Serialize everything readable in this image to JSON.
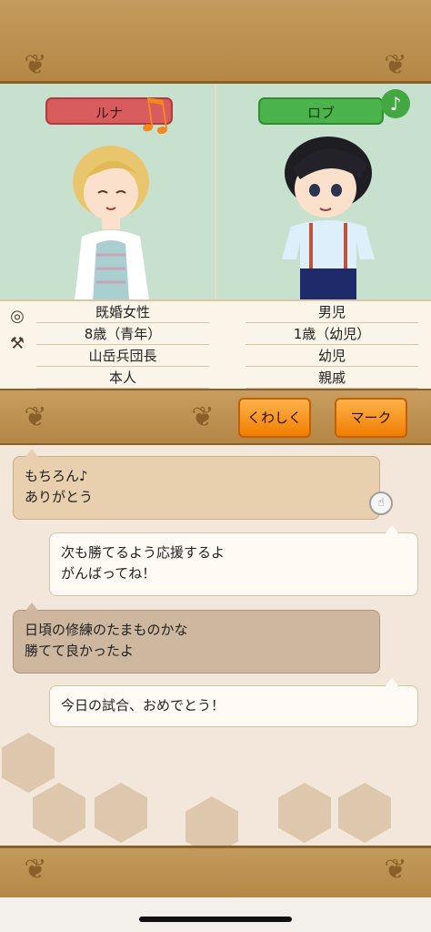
{
  "left_character": {
    "name": "ルナ",
    "info": [
      "既婚女性",
      "8歳（青年）",
      "山岳兵団長",
      "本人"
    ]
  },
  "right_character": {
    "name": "ロブ",
    "info": [
      "男児",
      "1歳（幼児）",
      "幼児",
      "親戚"
    ]
  },
  "icons": {
    "music": "♪",
    "big_note": "♫",
    "ring": "◎",
    "axe": "⚒",
    "tap": "☝"
  },
  "buttons": {
    "details": "くわしく",
    "mark": "マーク"
  },
  "chat": [
    {
      "speaker": "partner",
      "text": "もちろん♪\nありがとう"
    },
    {
      "speaker": "me",
      "text": "次も勝てるよう応援するよ\nがんばってね！"
    },
    {
      "speaker": "partner",
      "text": "日頃の修練のたまものかな\n勝てて良かったよ"
    },
    {
      "speaker": "me",
      "text": "今日の試合、おめでとう！"
    }
  ],
  "colors": {
    "frame": "#b58846",
    "profile_bg": "#c8e1cf",
    "left_tag": "#d85b5e",
    "right_tag": "#4bb34b",
    "button": "#f07e00"
  }
}
